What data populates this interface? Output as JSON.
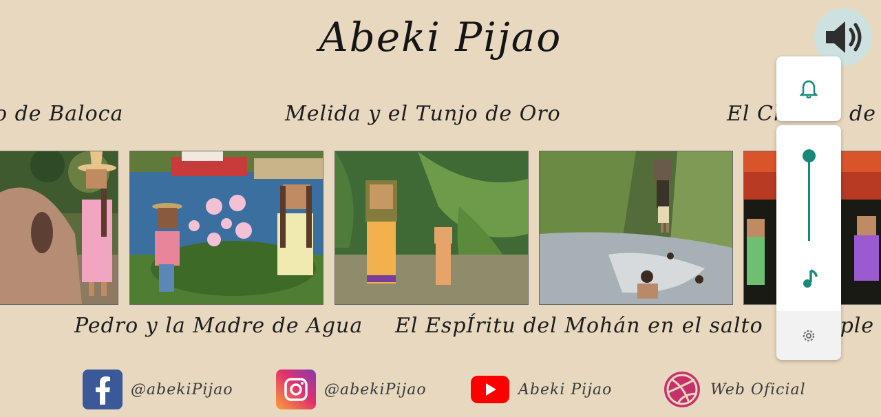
{
  "app": {
    "title": "Abeki Pijao"
  },
  "stories": {
    "top": [
      {
        "label": "o de Baloca"
      },
      {
        "label": "Melida y el Tunjo de Oro"
      },
      {
        "label": "El Ch"
      },
      {
        "label": "de"
      }
    ],
    "bottom": [
      {
        "label": "Pedro y la Madre de Agua"
      },
      {
        "label": "El EspÍritu del Mohán en el salto"
      },
      {
        "label": "iple"
      }
    ]
  },
  "social": [
    {
      "network": "facebook",
      "icon": "facebook-icon",
      "handle": "@abekiPijao",
      "color": "#3b5998"
    },
    {
      "network": "instagram",
      "icon": "instagram-icon",
      "handle": "@abekiPijao",
      "color": "#c13584"
    },
    {
      "network": "youtube",
      "icon": "youtube-icon",
      "handle": "Abeki Pijao",
      "color": "#ff0000"
    },
    {
      "network": "dribbble",
      "icon": "dribbble-icon",
      "handle": "Web Oficial",
      "color": "#c7306b"
    }
  ],
  "volume_panel": {
    "level": 0.72,
    "accent": "#16897a",
    "icons": [
      "speaker-icon",
      "bell-icon",
      "music-note-icon",
      "gear-icon"
    ]
  }
}
